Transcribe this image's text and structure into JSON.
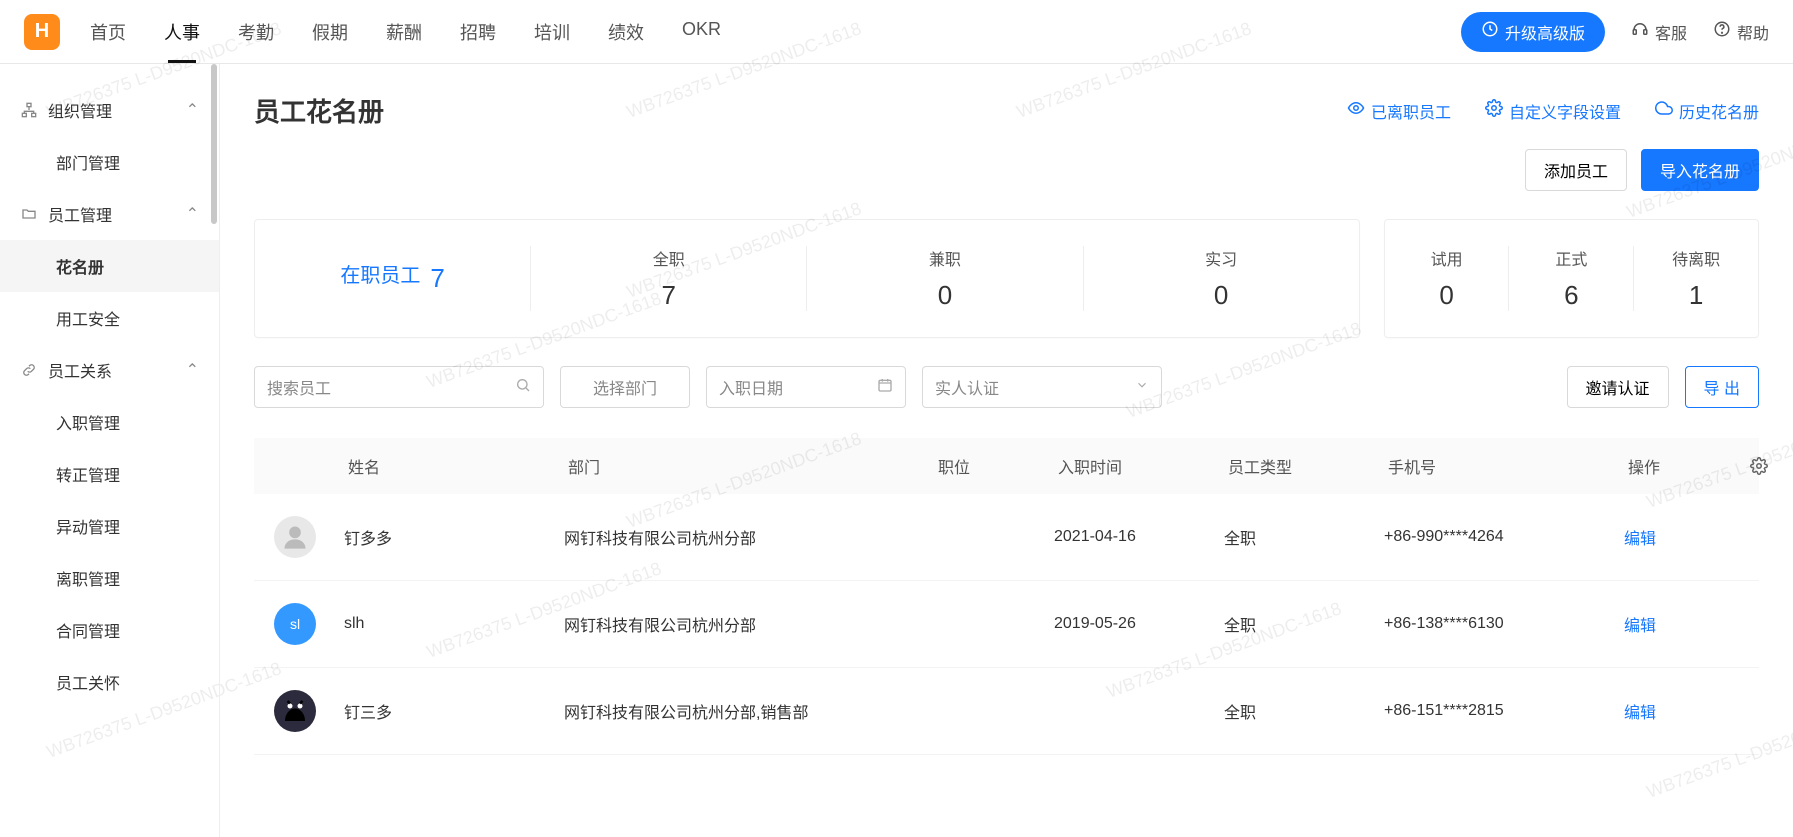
{
  "watermark": "WB726375 L-D9520NDC-1618",
  "logo_letter": "H",
  "topnav": {
    "items": [
      {
        "label": "首页"
      },
      {
        "label": "人事",
        "active": true
      },
      {
        "label": "考勤"
      },
      {
        "label": "假期"
      },
      {
        "label": "薪酬"
      },
      {
        "label": "招聘"
      },
      {
        "label": "培训"
      },
      {
        "label": "绩效"
      },
      {
        "label": "OKR"
      }
    ],
    "upgrade": "升级高级版",
    "support": "客服",
    "help": "帮助"
  },
  "sidebar": {
    "groups": [
      {
        "id": "org",
        "title": "组织管理",
        "items": [
          {
            "label": "部门管理"
          }
        ]
      },
      {
        "id": "emp",
        "title": "员工管理",
        "items": [
          {
            "label": "花名册",
            "active": true
          },
          {
            "label": "用工安全"
          }
        ]
      },
      {
        "id": "rel",
        "title": "员工关系",
        "items": [
          {
            "label": "入职管理"
          },
          {
            "label": "转正管理"
          },
          {
            "label": "异动管理"
          },
          {
            "label": "离职管理"
          },
          {
            "label": "合同管理"
          },
          {
            "label": "员工关怀"
          }
        ]
      }
    ]
  },
  "page": {
    "title": "员工花名册",
    "actions": {
      "leave": "已离职员工",
      "custom": "自定义字段设置",
      "history": "历史花名册",
      "add_emp": "添加员工",
      "import": "导入花名册",
      "invite": "邀请认证",
      "export": "导 出"
    }
  },
  "stats": {
    "big": [
      {
        "label": "在职员工",
        "value": "7",
        "active": true
      },
      {
        "label": "全职",
        "value": "7"
      },
      {
        "label": "兼职",
        "value": "0"
      },
      {
        "label": "实习",
        "value": "0"
      }
    ],
    "small": [
      {
        "label": "试用",
        "value": "0"
      },
      {
        "label": "正式",
        "value": "6"
      },
      {
        "label": "待离职",
        "value": "1"
      }
    ]
  },
  "filters": {
    "search_placeholder": "搜索员工",
    "dept": "选择部门",
    "date": "入职日期",
    "auth": "实人认证"
  },
  "table": {
    "headers": {
      "name": "姓名",
      "dept": "部门",
      "pos": "职位",
      "hire": "入职时间",
      "type": "员工类型",
      "phone": "手机号",
      "op": "操作"
    },
    "rows": [
      {
        "avatar": "img",
        "name": "钉多多",
        "dept": "网钉科技有限公司杭州分部",
        "pos": "",
        "hire": "2021-04-16",
        "type": "全职",
        "phone": "+86-990****4264",
        "op": "编辑"
      },
      {
        "avatar": "sl",
        "name": "slh",
        "dept": "网钉科技有限公司杭州分部",
        "pos": "",
        "hire": "2019-05-26",
        "type": "全职",
        "phone": "+86-138****6130",
        "op": "编辑"
      },
      {
        "avatar": "cat",
        "name": "钉三多",
        "dept": "网钉科技有限公司杭州分部,销售部",
        "pos": "",
        "hire": "",
        "type": "全职",
        "phone": "+86-151****2815",
        "op": "编辑"
      }
    ]
  }
}
